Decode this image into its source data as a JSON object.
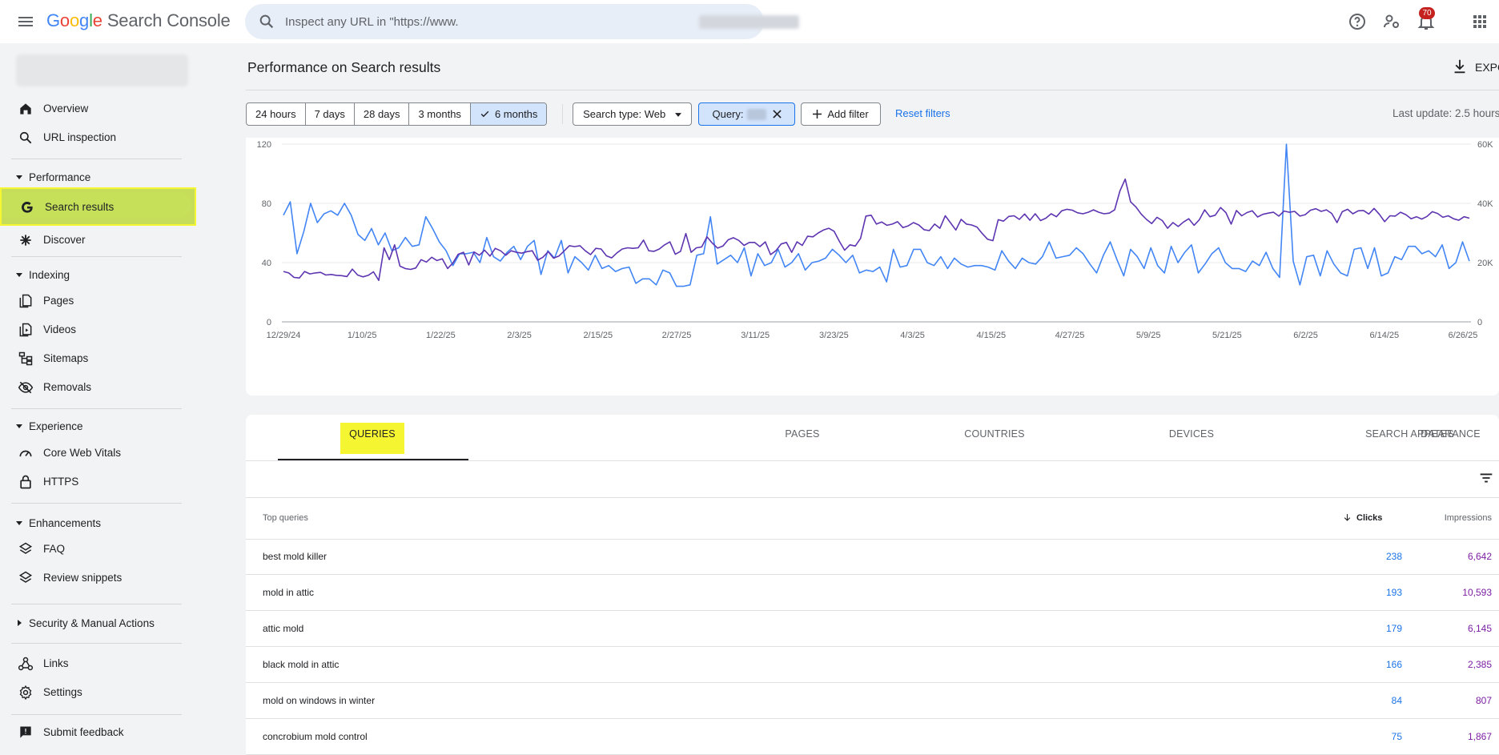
{
  "app": {
    "logo_letters": [
      "G",
      "o",
      "o",
      "g",
      "l",
      "e"
    ],
    "product": "Search Console",
    "search_placeholder": "Inspect any URL in \"https://www.",
    "notification_count": "70"
  },
  "sidebar": {
    "items": [
      {
        "label": "Overview",
        "icon": "home-icon"
      },
      {
        "label": "URL inspection",
        "icon": "search-icon"
      }
    ],
    "sections": [
      {
        "label": "Performance",
        "items": [
          {
            "label": "Search results",
            "icon": "google-g-icon",
            "active": true
          },
          {
            "label": "Discover",
            "icon": "asterisk-icon"
          }
        ]
      },
      {
        "label": "Indexing",
        "items": [
          {
            "label": "Pages",
            "icon": "pages-icon"
          },
          {
            "label": "Videos",
            "icon": "video-icon"
          },
          {
            "label": "Sitemaps",
            "icon": "sitemap-icon"
          },
          {
            "label": "Removals",
            "icon": "eye-off-icon"
          }
        ]
      },
      {
        "label": "Experience",
        "items": [
          {
            "label": "Core Web Vitals",
            "icon": "gauge-icon"
          },
          {
            "label": "HTTPS",
            "icon": "lock-icon"
          }
        ]
      },
      {
        "label": "Enhancements",
        "items": [
          {
            "label": "FAQ",
            "icon": "layers-icon"
          },
          {
            "label": "Review snippets",
            "icon": "layers-icon"
          }
        ]
      },
      {
        "label": "Security & Manual Actions",
        "collapsed": true,
        "items": []
      }
    ],
    "bottom_items": [
      {
        "label": "Links",
        "icon": "links-icon"
      },
      {
        "label": "Settings",
        "icon": "gear-icon"
      },
      {
        "label": "Submit feedback",
        "icon": "feedback-icon"
      }
    ]
  },
  "main": {
    "title": "Performance on Search results",
    "export_label": "EXPO",
    "date_ranges": [
      "24 hours",
      "7 days",
      "28 days",
      "3 months",
      "6 months"
    ],
    "selected_range": "6 months",
    "search_type_chip": "Search type: Web",
    "query_chip": "Query:",
    "add_filter": "Add filter",
    "reset_filters": "Reset filters",
    "last_update": "Last update: 2.5 hours"
  },
  "colors": {
    "clicks": "#4285f4",
    "impressions": "#5e35b1",
    "active_nav": "#c6e05a",
    "highlight": "#f5f531",
    "link": "#1a73e8"
  },
  "chart_data": {
    "type": "line",
    "x_tick_labels": [
      "12/29/24",
      "1/10/25",
      "1/22/25",
      "2/3/25",
      "2/15/25",
      "2/27/25",
      "3/11/25",
      "3/23/25",
      "4/3/25",
      "4/15/25",
      "4/27/25",
      "5/9/25",
      "5/21/25",
      "6/2/25",
      "6/14/25",
      "6/26/25"
    ],
    "y_left_ticks": [
      "0",
      "40",
      "80",
      "120"
    ],
    "y_right_ticks": [
      "0",
      "20K",
      "40K",
      "60K"
    ],
    "ylim_left": [
      0,
      120
    ],
    "ylim_right": [
      0,
      60000
    ],
    "grid": true,
    "series": [
      {
        "axis": "left",
        "values": [
          72,
          81,
          46,
          61,
          80,
          67,
          73,
          75,
          72,
          80,
          72,
          59,
          55,
          63,
          52,
          60,
          48,
          50,
          57,
          51,
          52,
          71,
          63,
          54,
          48,
          38,
          46,
          46,
          47,
          40,
          57,
          44,
          41,
          47,
          51,
          42,
          51,
          55,
          32,
          48,
          43,
          55,
          33,
          44,
          40,
          35,
          45,
          36,
          38,
          34,
          36,
          37,
          26,
          29,
          29,
          25,
          35,
          33,
          24,
          24,
          25,
          45,
          46,
          71,
          39,
          42,
          45,
          40,
          50,
          31,
          46,
          38,
          40,
          49,
          37,
          40,
          46,
          35,
          40,
          41,
          43,
          49,
          45,
          40,
          45,
          33,
          35,
          34,
          37,
          27,
          49,
          37,
          38,
          49,
          49,
          40,
          38,
          44,
          36,
          43,
          39,
          37,
          38,
          38,
          37,
          35,
          48,
          41,
          36,
          43,
          40,
          39,
          44,
          54,
          43,
          44,
          45,
          50,
          46,
          39,
          33,
          45,
          54,
          42,
          31,
          49,
          44,
          36,
          50,
          38,
          33,
          51,
          40,
          47,
          52,
          33,
          39,
          46,
          50,
          40,
          36,
          36,
          34,
          41,
          38,
          47,
          36,
          30,
          120,
          41,
          25,
          44,
          45,
          31,
          48,
          39,
          33,
          31,
          49,
          50,
          36,
          50,
          31,
          33,
          44,
          42,
          51,
          51,
          46,
          48,
          44,
          52,
          36,
          40,
          54,
          41
        ],
        "color": "#4285f4"
      },
      {
        "axis": "right",
        "values": [
          17000,
          16500,
          15000,
          14800,
          17000,
          16200,
          16500,
          16700,
          15800,
          16000,
          15700,
          15600,
          15300,
          17800,
          15800,
          15200,
          15700,
          16900,
          14000,
          25000,
          21000,
          26000,
          18800,
          18000,
          17700,
          18200,
          21000,
          20200,
          21800,
          20700,
          21300,
          18000,
          19900,
          22800,
          23500,
          19200,
          23600,
          22500,
          24200,
          22200,
          24800,
          24000,
          22500,
          24000,
          23500,
          23200,
          23700,
          24000,
          20800,
          21800,
          23700,
          21500,
          22200,
          23900,
          25700,
          25400,
          25700,
          24000,
          22700,
          24800,
          24600,
          22300,
          21600,
          23300,
          24600,
          25000,
          24800,
          25000,
          27600,
          24000,
          23800,
          24600,
          26000,
          27000,
          22800,
          23800,
          29800,
          23500,
          25000,
          25300,
          28700,
          26600,
          24900,
          25600,
          27700,
          28400,
          27500,
          25800,
          26800,
          26800,
          25400,
          27000,
          22700,
          24000,
          26300,
          26800,
          23500,
          27000,
          25800,
          28900,
          28700,
          30000,
          31000,
          31600,
          30600,
          27200,
          24200,
          26000,
          25600,
          28200,
          35700,
          36000,
          33000,
          33700,
          32600,
          33000,
          33800,
          31800,
          32400,
          33500,
          32700,
          31100,
          30800,
          33000,
          31600,
          35800,
          33400,
          31000,
          34600,
          33000,
          32700,
          32000,
          29800,
          27900,
          27400,
          34500,
          34000,
          35600,
          35800,
          34600,
          36400,
          34300,
          36500,
          34200,
          35000,
          36500,
          35500,
          37500,
          38000,
          37700,
          36800,
          36500,
          37000,
          37800,
          37000,
          36500,
          36700,
          37800,
          44200,
          48200,
          40500,
          38800,
          36400,
          34600,
          33200,
          35300,
          34200,
          31600,
          33500,
          32200,
          33700,
          34800,
          32600,
          34500,
          37800,
          35500,
          36000,
          38600,
          36900,
          33000,
          37600,
          35800,
          36900,
          37500,
          35400,
          36300,
          36700,
          37000,
          35700,
          37400,
          37000,
          37300,
          35700,
          36200,
          37700,
          38200,
          37300,
          37800,
          36600,
          33500,
          37200,
          38000,
          36500,
          37500,
          37600,
          36400,
          38300,
          36300,
          33800,
          35800,
          35700,
          37000,
          36200,
          34800,
          35500,
          34700,
          35600,
          37200,
          36600,
          35300,
          35800,
          34800,
          34300,
          35500,
          35000
        ],
        "color": "#5e35b1"
      }
    ]
  },
  "table": {
    "tabs": [
      "QUERIES",
      "PAGES",
      "COUNTRIES",
      "DEVICES",
      "SEARCH APPEARANCE",
      "DATES"
    ],
    "selected_tab": "QUERIES",
    "headers": {
      "query": "Top queries",
      "clicks": "Clicks",
      "impressions": "Impressions"
    },
    "sort": "clicks-descending",
    "rows": [
      {
        "query": "best mold killer",
        "clicks": "238",
        "impressions": "6,642"
      },
      {
        "query": "mold in attic",
        "clicks": "193",
        "impressions": "10,593"
      },
      {
        "query": "attic mold",
        "clicks": "179",
        "impressions": "6,145"
      },
      {
        "query": "black mold in attic",
        "clicks": "166",
        "impressions": "2,385"
      },
      {
        "query": "mold on windows in winter",
        "clicks": "84",
        "impressions": "807"
      },
      {
        "query": "concrobium mold control",
        "clicks": "75",
        "impressions": "1,867"
      }
    ]
  }
}
